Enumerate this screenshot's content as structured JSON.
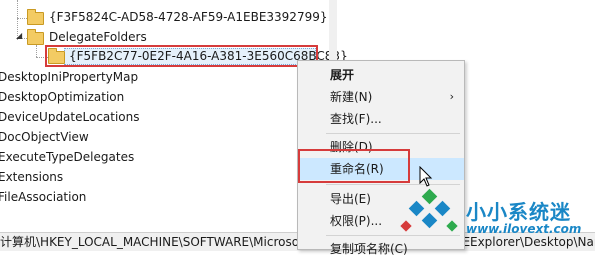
{
  "tree": {
    "guid_top": "{F3F5824C-AD58-4728-AF59-A1EBE3392799}",
    "delegate_folders": "DelegateFolders",
    "selected_guid": "{F5FB2C77-0E2F-4A16-A381-3E560C68BC83}",
    "items": [
      "DesktopIniPropertyMap",
      "DesktopOptimization",
      "DeviceUpdateLocations",
      "DocObjectView",
      "ExecuteTypeDelegates",
      "Extensions",
      "FileAssociation"
    ]
  },
  "statusbar": {
    "path": "计算机\\HKEY_LOCAL_MACHINE\\SOFTWARE\\Microsoft\\Windows\\CurrentVersion\\Explorer\\Desktop\\NameSpace",
    "path_tail": "Explorer\\Desktop\\Nar"
  },
  "menu": {
    "expand": "展开",
    "new": "新建(N)",
    "find": "查找(F)...",
    "delete": "删除(D)",
    "rename": "重命名(R)",
    "export": "导出(E)",
    "permissions": "权限(P)...",
    "copy_key_name": "复制项名称(C)"
  },
  "watermark": {
    "name": "小小系统迷",
    "url": "www.ilovext.com",
    "colors": [
      "#1a87c6",
      "#2eaa4e",
      "#d63b3b"
    ]
  }
}
